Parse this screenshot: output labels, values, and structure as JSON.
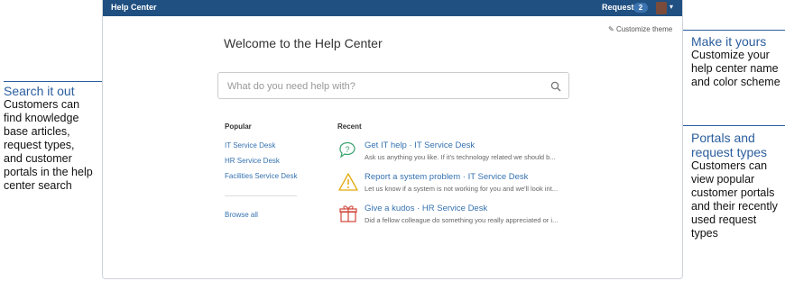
{
  "app": {
    "brand": "Help Center",
    "requests_label": "Requests",
    "requests_count": "2",
    "customize_theme": "Customize theme",
    "welcome_title": "Welcome to the Help Center",
    "search": {
      "placeholder": "What do you need help with?"
    },
    "popular": {
      "heading": "Popular",
      "items": [
        "IT Service Desk",
        "HR Service Desk",
        "Facilities Service Desk"
      ],
      "browse_all": "Browse all"
    },
    "recent": {
      "heading": "Recent",
      "items": [
        {
          "title": "Get IT help · IT Service Desk",
          "desc": "Ask us anything you like. If it's technology related we should b...",
          "icon": "chat-question-icon"
        },
        {
          "title": "Report a system problem · IT Service Desk",
          "desc": "Let us know if a system is not working for you and we'll look int...",
          "icon": "warning-icon"
        },
        {
          "title": "Give a kudos · HR Service Desk",
          "desc": "Did a fellow colleague do something you really appreciated or i...",
          "icon": "gift-icon"
        }
      ]
    }
  },
  "callouts": {
    "search": {
      "title": "Search it out",
      "body": [
        "Customers can",
        "find knowledge",
        "base articles,",
        "request types,",
        "and customer",
        "portals in the help",
        "center search"
      ]
    },
    "theme": {
      "title": "Make it yours",
      "body": [
        "Customize your",
        "help center name",
        "and color scheme"
      ]
    },
    "portals": {
      "title_lines": [
        "Portals and",
        "request types"
      ],
      "body": [
        "Customers can",
        "view popular",
        "customer portals",
        "and their recently",
        "used request",
        "types"
      ]
    }
  },
  "colors": {
    "topbar": "#205081",
    "link": "#3572b0",
    "callout": "#2b5e9e"
  }
}
